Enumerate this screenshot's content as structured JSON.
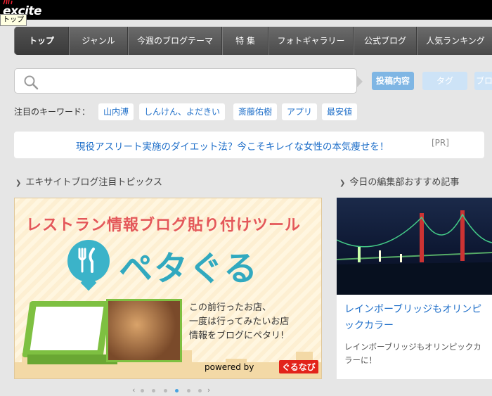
{
  "brand": {
    "logo_text": "excite",
    "tooltip": "トップ"
  },
  "nav": {
    "items": [
      {
        "label": "トップ",
        "active": true
      },
      {
        "label": "ジャンル"
      },
      {
        "label": "今週のブログテーマ"
      },
      {
        "label": "特 集"
      },
      {
        "label": "フォトギャラリー"
      },
      {
        "label": "公式ブログ"
      },
      {
        "label": "人気ランキング"
      }
    ]
  },
  "search": {
    "placeholder": "",
    "tabs": [
      "投稿内容",
      "タグ",
      "ブログ"
    ]
  },
  "keywords": {
    "label": "注目のキーワード：",
    "items": [
      "山内溥",
      "しんけん、よだきい",
      "斎藤佑樹",
      "アプリ",
      "最安値"
    ]
  },
  "pr": {
    "text": "現役アスリート実施のダイエット法？今こそキレイな女性の本気痩せを！",
    "tag": "[PR]"
  },
  "sections": {
    "left_title": "エキサイトブログ注目トピックス",
    "right_title": "今日の編集部おすすめ記事"
  },
  "banner": {
    "title": "レストラン情報ブログ貼り付けツール",
    "brand": "ペタぐる",
    "copy_lines": [
      "この前行ったお店、",
      "一度は行ってみたいお店",
      "情報をブログにペタリ!"
    ],
    "powered": "powered by",
    "partner": "ぐるなび"
  },
  "carousel": {
    "count": 6,
    "active_index": 3
  },
  "card": {
    "title": "レインボーブリッジもオリンピックカラー",
    "description": "レインボーブリッジもオリンピックカラーに！"
  }
}
